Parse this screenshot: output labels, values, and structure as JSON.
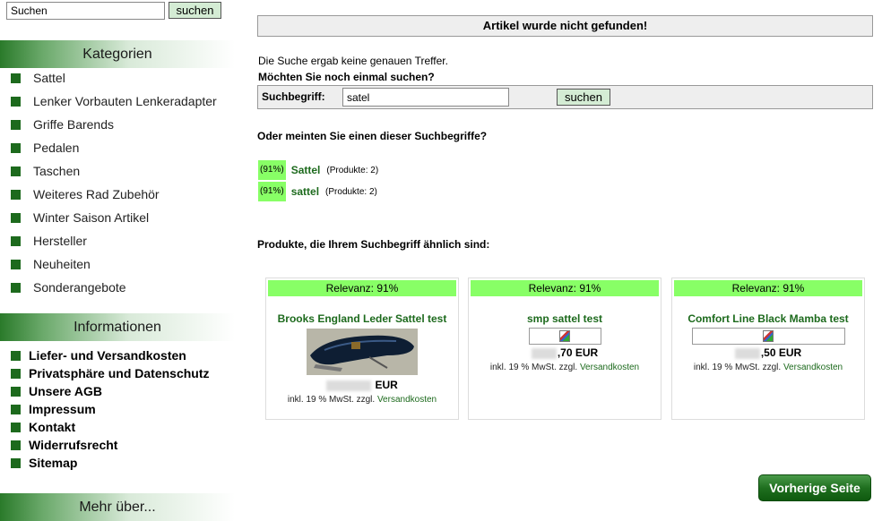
{
  "sidebar": {
    "search_value": "Suchen",
    "search_button": "suchen",
    "categories_title": "Kategorien",
    "categories": [
      {
        "label": "Sattel"
      },
      {
        "label": "Lenker Vorbauten Lenkeradapter"
      },
      {
        "label": "Griffe Barends"
      },
      {
        "label": "Pedalen"
      },
      {
        "label": "Taschen"
      },
      {
        "label": "Weiteres Rad Zubehör"
      },
      {
        "label": "Winter Saison Artikel"
      },
      {
        "label": "Hersteller"
      },
      {
        "label": "Neuheiten"
      },
      {
        "label": "Sonderangebote"
      }
    ],
    "info_title": "Informationen",
    "info": [
      {
        "label": "Liefer- und Versandkosten"
      },
      {
        "label": "Privatsphäre und Datenschutz"
      },
      {
        "label": "Unsere AGB"
      },
      {
        "label": "Impressum"
      },
      {
        "label": "Kontakt"
      },
      {
        "label": "Widerrufsrecht"
      },
      {
        "label": "Sitemap"
      }
    ],
    "more_title": "Mehr über..."
  },
  "main": {
    "title": "Artikel wurde nicht gefunden!",
    "no_exact": "Die Suche ergab keine genauen Treffer.",
    "search_again": "Möchten Sie noch einmal suchen?",
    "search_label": "Suchbegriff:",
    "search_value": "satel",
    "search_button": "suchen",
    "did_you_mean": "Oder meinten Sie einen dieser Suchbegriffe?",
    "suggestions": [
      {
        "pct": "(91%)",
        "word": "Sattel",
        "count": "(Produkte: 2)"
      },
      {
        "pct": "(91%)",
        "word": "sattel",
        "count": "(Produkte: 2)"
      }
    ],
    "similar_title": "Produkte, die Ihrem Suchbegriff ähnlich sind:",
    "products": [
      {
        "relevance": "Relevanz: 91%",
        "name": "Brooks England Leder Sattel test",
        "price_suffix": "EUR",
        "tax": "inkl. 19 % MwSt. zzgl.",
        "shipping": "Versandkosten"
      },
      {
        "relevance": "Relevanz: 91%",
        "name": "smp sattel test",
        "price_suffix": ",70 EUR",
        "tax": "inkl. 19 % MwSt. zzgl.",
        "shipping": "Versandkosten"
      },
      {
        "relevance": "Relevanz: 91%",
        "name": "Comfort Line Black Mamba test",
        "price_suffix": ",50 EUR",
        "tax": "inkl. 19 % MwSt. zzgl.",
        "shipping": "Versandkosten"
      }
    ],
    "prev_button": "Vorherige Seite"
  },
  "colors": {
    "accent_green": "#1d6a1d",
    "relevance_bg": "#88ff66",
    "header_bg": "#eeeeee"
  },
  "icons": {
    "bullet": "green-square-icon",
    "missing_image": "broken-image-icon"
  }
}
